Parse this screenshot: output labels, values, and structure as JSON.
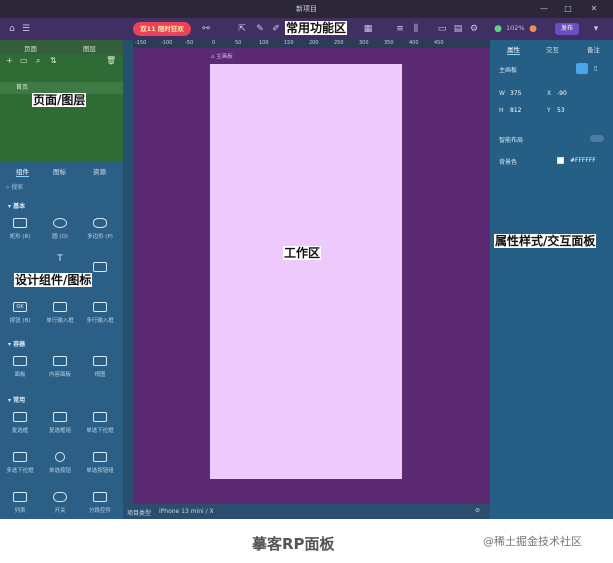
{
  "window": {
    "title": "新项目"
  },
  "toolbar": {
    "promo": "双11 限时狂欢",
    "zoom": "102%",
    "publish": "发布"
  },
  "left_panel": {
    "tabs": [
      "页面",
      "图层"
    ],
    "pages": [
      "首页"
    ],
    "section_tabs": [
      "组件",
      "图标",
      "资源"
    ],
    "search_placeholder": "搜索",
    "categories": [
      {
        "name": "基本",
        "items": [
          "矩形 (R)",
          "圆 (O)",
          "多边形 (P)",
          "",
          "",
          "",
          "按钮 (B)",
          "单行输入框",
          "多行输入框"
        ]
      },
      {
        "name": "容器",
        "items": [
          "面板",
          "内容面板",
          "视图"
        ]
      },
      {
        "name": "常用",
        "items": [
          "复选框",
          "复选框组",
          "单选下拉框",
          "多选下拉框",
          "单选按钮",
          "单选按钮组",
          "列表",
          "开关",
          "分段控件"
        ]
      }
    ]
  },
  "ruler_ticks": [
    "-150",
    "-100",
    "-50",
    "0",
    "50",
    "100",
    "150",
    "200",
    "250",
    "300",
    "350",
    "400",
    "450"
  ],
  "canvas": {
    "artboard_label": "主画板"
  },
  "right_panel": {
    "tabs": [
      "属性",
      "交互",
      "备注"
    ],
    "artboard_name": "主画板",
    "w_label": "W",
    "w": "375",
    "h_label": "H",
    "h": "812",
    "x_label": "X",
    "x": "-90",
    "y_label": "Y",
    "y": "53",
    "layout_label": "智能布局",
    "bg_label": "背景色",
    "bg_value": "#FFFFFF"
  },
  "statusbar": {
    "label": "项目类型",
    "device": "iPhone 13 mini / X"
  },
  "annotations": {
    "toolbar": "常用功能区",
    "pages": "页面/图层",
    "components": "设计组件/图标",
    "work": "工作区",
    "props": "属性样式/交互面板"
  },
  "caption": {
    "title": "摹客RP面板",
    "watermark": "@稀土掘金技术社区"
  },
  "colors": {
    "toolbar": "#3f2f63",
    "panel": "#2c5f86",
    "pages": "#2f6b35",
    "canvas": "#5b2a73",
    "artboard": "#eec9fb"
  }
}
